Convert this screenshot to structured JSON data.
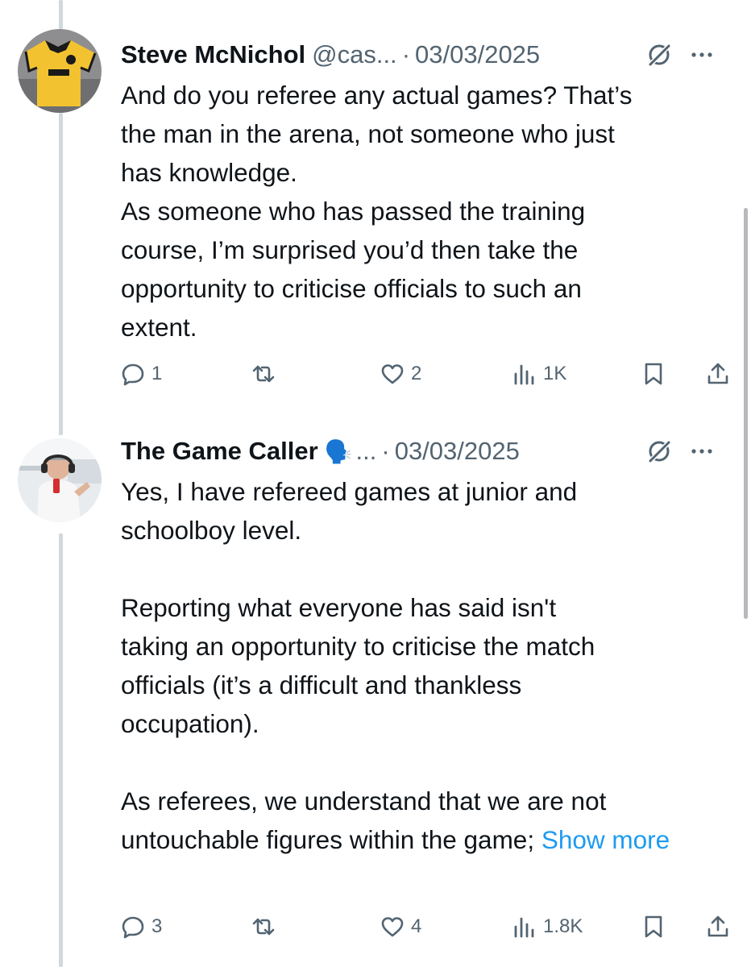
{
  "tweets": [
    {
      "author": "Steve McNichol",
      "handle": "@cas...",
      "separator": "·",
      "date": "03/03/2025",
      "lines": [
        "And do you referee any actual games? That’s",
        "the man in the arena, not someone who just",
        "has knowledge.",
        "As someone who has passed the training",
        "course, I’m surprised you’d then take the",
        "opportunity to criticise officials to such an",
        "extent."
      ],
      "replies": "1",
      "retweets": "",
      "likes": "2",
      "views": "1K"
    },
    {
      "author": "The Game Caller",
      "author_emoji": "🗣️",
      "handle": "...",
      "separator": "·",
      "date": "03/03/2025",
      "lines": [
        "Yes, I have refereed games at junior and",
        "schoolboy level.",
        "",
        "Reporting what everyone has said isn't",
        "taking an opportunity to criticise the match",
        "officials (it’s a difficult and thankless",
        "occupation).",
        "",
        "As referees, we understand that we are not"
      ],
      "last_line": "untouchable figures within the game; ",
      "show_more": "Show more",
      "replies": "3",
      "retweets": "",
      "likes": "4",
      "views": "1.8K"
    }
  ],
  "colors": {
    "text": "#0f1419",
    "secondary": "#536471",
    "link": "#1d9bf0",
    "thread_line": "#cfd9de"
  },
  "icons": [
    "reply-icon",
    "retweet-icon",
    "like-icon",
    "views-icon",
    "bookmark-icon",
    "share-icon",
    "grok-icon",
    "more-icon"
  ]
}
